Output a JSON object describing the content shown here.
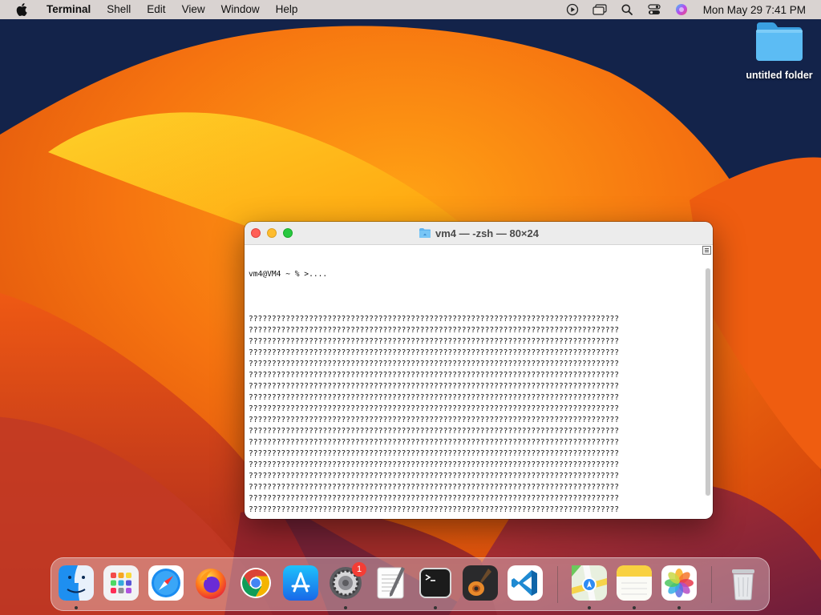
{
  "menubar": {
    "app_name": "Terminal",
    "menus": [
      "Shell",
      "Edit",
      "View",
      "Window",
      "Help"
    ],
    "clock": "Mon May 29  7:41 PM"
  },
  "desktop": {
    "folder_label": "untitled folder"
  },
  "terminal": {
    "title": "vm4 — -zsh — 80×24",
    "prompt_line": "vm4@VM4 ~ % >....",
    "output_line": "????????????????????????????????????????????????????????????????????????????????",
    "output_line_count": 22,
    "last_line": "????"
  },
  "dock": {
    "apps": [
      "finder-icon",
      "launchpad-icon",
      "safari-icon",
      "firefox-icon",
      "chrome-icon",
      "app-store-icon",
      "system-settings-icon",
      "textedit-icon",
      "terminal-icon",
      "garageband-icon",
      "vscode-icon",
      "maps-icon",
      "notes-icon",
      "photos-icon",
      "trash-icon"
    ],
    "settings_badge": "1"
  },
  "colors": {
    "wallpaper_orange": "#f26a12",
    "wallpaper_navy": "#13234a",
    "folder_blue": "#4fb3f0"
  }
}
